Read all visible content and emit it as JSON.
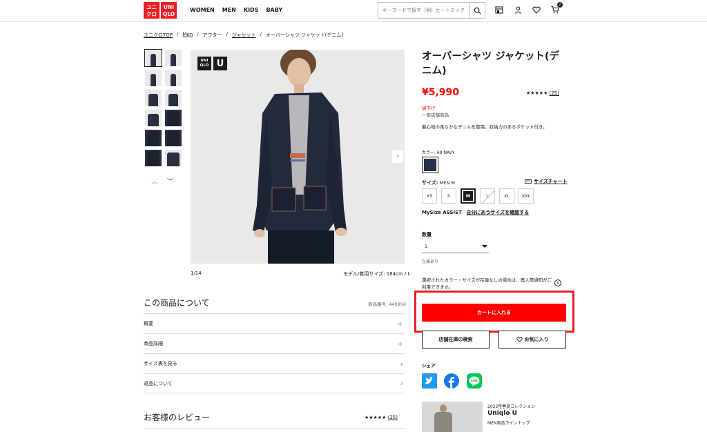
{
  "header": {
    "logo_top": "ユニ\nクロ",
    "logo_bottom": "UNI\nQLO",
    "nav": [
      "WOMEN",
      "MEN",
      "KIDS",
      "BABY"
    ],
    "search_placeholder": "キーワードで探す（例）ヒートテック",
    "cart_count": "2"
  },
  "breadcrumb": [
    "ユニクロTOP",
    "/",
    "Men",
    "/",
    "アウター",
    "/",
    "ジャケット",
    "/",
    "オーバーシャツ ジャケット(デニム)"
  ],
  "gallery": {
    "badge_left": "UNI\nQLO",
    "badge_right": "U",
    "counter": "1/14",
    "model_info": "モデル/着用サイズ: 184cm / L"
  },
  "about": {
    "title": "この商品について",
    "product_no": "商品番号: 440956",
    "rows": [
      {
        "label": "概要",
        "sym": "+"
      },
      {
        "label": "商品詳細",
        "sym": "+"
      },
      {
        "label": "サイズ表を見る",
        "sym": "›"
      },
      {
        "label": "返品について",
        "sym": "›"
      }
    ]
  },
  "reviews": {
    "title": "お客様のレビュー",
    "stars": "★★★★★",
    "count": "(25)"
  },
  "product": {
    "title": "オーバーシャツ ジャケット(デニム)",
    "price": "¥5,990",
    "stars": "★★★★★",
    "review_count": "(25)",
    "price_down": "値下げ",
    "partial_store": "一部店舗商品",
    "description": "着心地の柔らかなデニムを使用。収納力のあるポケット付き。",
    "color_label": "カラー:  69 NAVY",
    "size_label": "サイズ:",
    "size_value": "MEN M",
    "size_chart": "サイズチャート",
    "sizes": [
      "XS",
      "S",
      "M",
      "L",
      "XL",
      "XXL"
    ],
    "mysize_label": "MySize  ASSIST",
    "mysize_link": "自分にあうサイズを確認する",
    "qty_label": "数量",
    "qty_value": "1",
    "stock": "在庫あり",
    "notice": "選択されたカラー・サイズが在庫なしの場合は、再入荷通知がご利用できます。",
    "add_to_cart": "カートに入れる",
    "store_stock": "店舗在庫の検索",
    "favorite": "お気に入り",
    "share_label": "シェア"
  },
  "promo": {
    "subtitle": "2022年春夏コレクション",
    "title": "Uniqlo U",
    "desc": "MEN商品ラインナップ"
  },
  "colors": {
    "brand_red": "#ed1d24",
    "price_red": "#ff0000",
    "highlight": "#e81c24",
    "twitter": "#1d9bf0",
    "facebook": "#1877f2",
    "line": "#06c755"
  }
}
